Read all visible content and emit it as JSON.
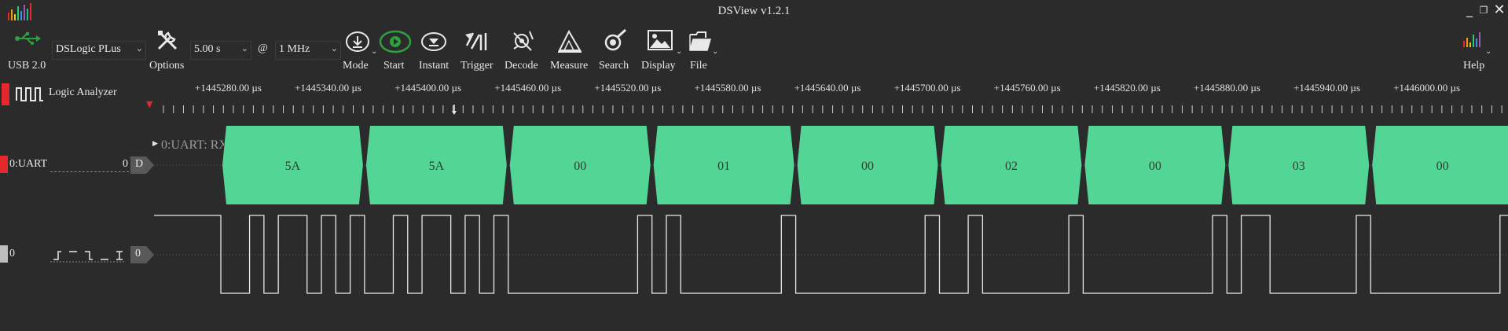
{
  "window": {
    "title": "DSView v1.2.1",
    "minimize_glyph": "_",
    "restore_glyph": "❐",
    "close_glyph": "✕"
  },
  "toolbar": {
    "usb_label": "USB 2.0",
    "device_select": "DSLogic PLus",
    "options_label": "Options",
    "duration_select": "5.00 s",
    "at_sign": "@",
    "samplerate_select": "1 MHz",
    "buttons": [
      {
        "label": "Mode",
        "icon": "mode-icon"
      },
      {
        "label": "Start",
        "icon": "start-icon"
      },
      {
        "label": "Instant",
        "icon": "instant-icon"
      },
      {
        "label": "Trigger",
        "icon": "trigger-icon"
      },
      {
        "label": "Decode",
        "icon": "decode-icon"
      },
      {
        "label": "Measure",
        "icon": "measure-icon"
      },
      {
        "label": "Search",
        "icon": "search-icon"
      },
      {
        "label": "Display",
        "icon": "display-icon"
      },
      {
        "label": "File",
        "icon": "file-icon"
      }
    ],
    "help_label": "Help",
    "colors": {
      "start_green": "#2ea043",
      "accent_red": "#e5282e"
    }
  },
  "mode_tab": {
    "label": "Logic Analyzer"
  },
  "ruler": {
    "labels": [
      "+1445280.00 µs",
      "+1445340.00 µs",
      "+1445400.00 µs",
      "+1445460.00 µs",
      "+1445520.00 µs",
      "+1445580.00 µs",
      "+1445640.00 µs",
      "+1445700.00 µs",
      "+1445760.00 µs",
      "+1445820.00 µs",
      "+1445880.00 µs",
      "+1445940.00 µs",
      "+1446000.00 µs"
    ]
  },
  "decoder_channel": {
    "name": "0:UART",
    "index": "0",
    "badge": "D",
    "row_label": "0:UART: RX",
    "color": "#53d695",
    "bytes": [
      "5A",
      "5A",
      "00",
      "01",
      "00",
      "02",
      "00",
      "03",
      "00"
    ]
  },
  "logic_channel": {
    "name": "0",
    "index": "0",
    "trigger_glyphs": "_‐‐ ‐‐_ ‐ ↕"
  }
}
